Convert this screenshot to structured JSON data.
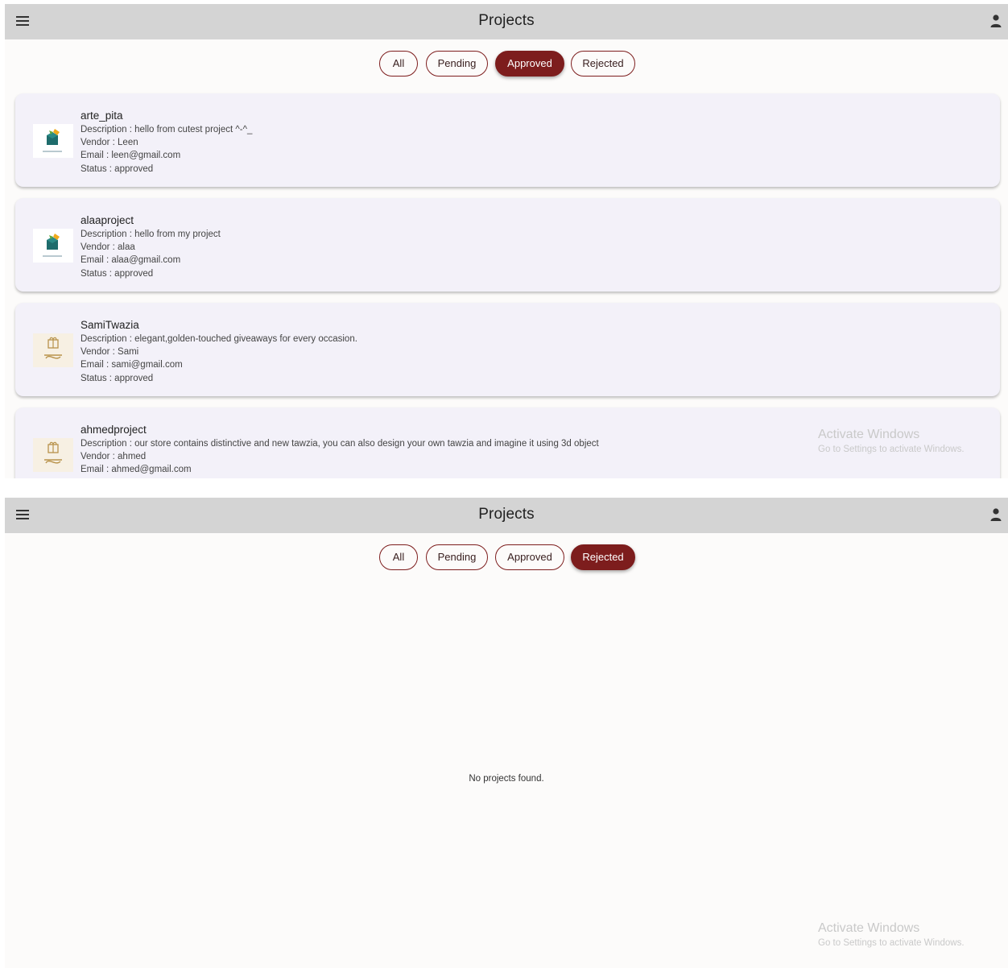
{
  "screen1": {
    "title": "Projects",
    "filters": [
      "All",
      "Pending",
      "Approved",
      "Rejected"
    ],
    "active_filter": "Approved",
    "projects": [
      {
        "name": "arte_pita",
        "description": "Description : hello from cutest project ^-^_",
        "vendor": "Vendor : Leen",
        "email": "Email : leen@gmail.com",
        "status": "Status : approved"
      },
      {
        "name": "alaaproject",
        "description": "Description : hello from my project",
        "vendor": "Vendor : alaa",
        "email": "Email : alaa@gmail.com",
        "status": "Status : approved"
      },
      {
        "name": "SamiTwazia",
        "description": "Description : elegant,golden-touched giveaways for every occasion.",
        "vendor": "Vendor : Sami",
        "email": "Email : sami@gmail.com",
        "status": "Status : approved"
      },
      {
        "name": "ahmedproject",
        "description": "Description : our store contains distinctive and new tawzia, you can also design your own tawzia and imagine it using 3d object",
        "vendor": "Vendor : ahmed",
        "email": "Email : ahmed@gmail.com",
        "status": ""
      }
    ],
    "watermark": {
      "line1": "Activate Windows",
      "line2": "Go to Settings to activate Windows."
    }
  },
  "screen2": {
    "title": "Projects",
    "filters": [
      "All",
      "Pending",
      "Approved",
      "Rejected"
    ],
    "active_filter": "Rejected",
    "empty_message": "No projects found.",
    "watermark": {
      "line1": "Activate Windows",
      "line2": "Go to Settings to activate Windows."
    }
  },
  "icons": {
    "menu": "hamburger-menu-icon",
    "profile": "person-icon",
    "thumb_a": "gift-box-logo",
    "thumb_b": "tawzia-gift-logo"
  },
  "colors": {
    "accent": "#7d1d1d",
    "appbar": "#d4d4d4",
    "card": "#f3f1f9",
    "background": "#fcfbfa"
  }
}
